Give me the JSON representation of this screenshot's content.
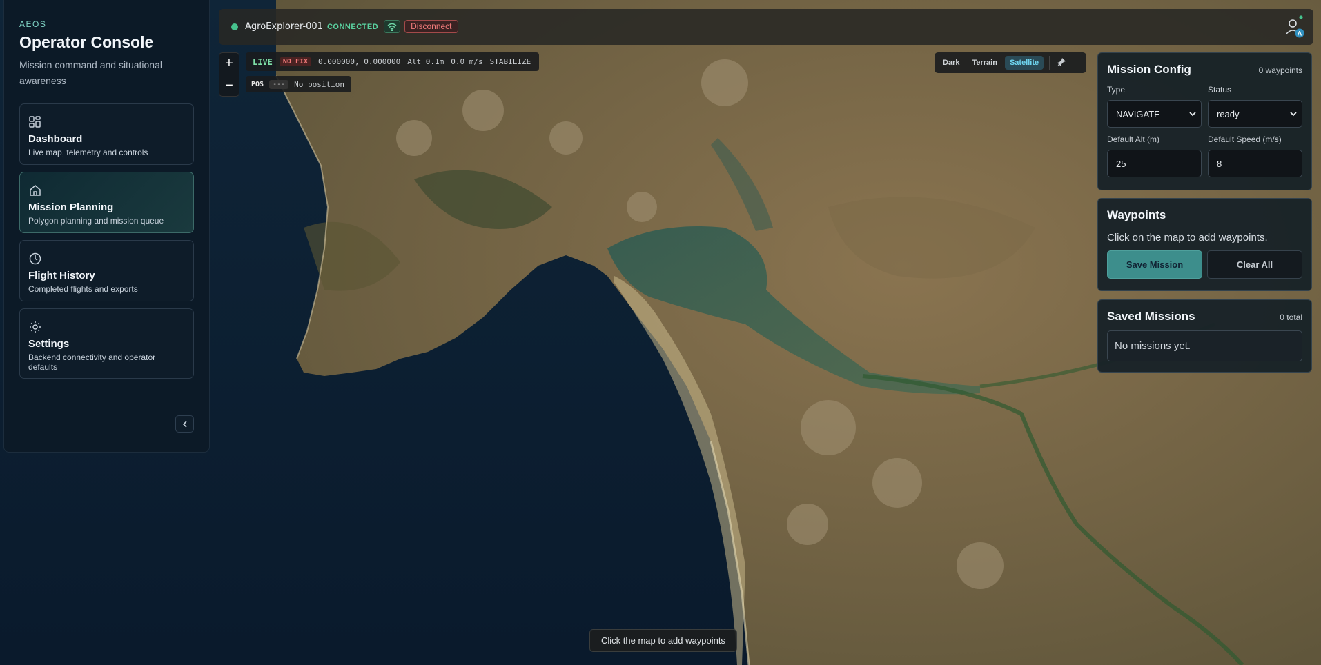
{
  "sidebar": {
    "brand": "AEOS",
    "title": "Operator Console",
    "subtitle": "Mission command and situational awareness",
    "items": [
      {
        "label": "Dashboard",
        "desc": "Live map, telemetry and controls",
        "icon": "grid-icon"
      },
      {
        "label": "Mission Planning",
        "desc": "Polygon planning and mission queue",
        "icon": "home-icon",
        "active": true
      },
      {
        "label": "Flight History",
        "desc": "Completed flights and exports",
        "icon": "clock-icon"
      },
      {
        "label": "Settings",
        "desc": "Backend connectivity and operator defaults",
        "icon": "sun-icon"
      }
    ]
  },
  "topbar": {
    "vehicle": "AgroExplorer-001",
    "status": "CONNECTED",
    "disconnect": "Disconnect",
    "avatar_initial": "A"
  },
  "zoom": {
    "in": "+",
    "out": "−"
  },
  "telemetry": {
    "live": "LIVE",
    "fix": "NO FIX",
    "coords": "0.000000, 0.000000",
    "alt": "Alt 0.1m",
    "speed": "0.0 m/s",
    "mode": "STABILIZE"
  },
  "position": {
    "label": "POS",
    "value": "---",
    "text": "No position"
  },
  "map_style": {
    "options": [
      "Dark",
      "Terrain",
      "Satellite"
    ],
    "selected": "Satellite"
  },
  "mission_config": {
    "title": "Mission Config",
    "count": "0 waypoints",
    "type_label": "Type",
    "type_value": "NAVIGATE",
    "status_label": "Status",
    "status_value": "ready",
    "alt_label": "Default Alt (m)",
    "alt_value": "25",
    "speed_label": "Default Speed (m/s)",
    "speed_value": "8"
  },
  "waypoints": {
    "title": "Waypoints",
    "hint": "Click on the map to add waypoints.",
    "save": "Save Mission",
    "clear": "Clear All"
  },
  "saved": {
    "title": "Saved Missions",
    "count": "0 total",
    "empty": "No missions yet."
  },
  "map_hint": "Click the map to add waypoints",
  "colors": {
    "accent": "#3d8e8c",
    "ok": "#46c28d",
    "danger": "#ef7a7a",
    "sea": "#0c1f34",
    "land": "#7a6a4a"
  }
}
